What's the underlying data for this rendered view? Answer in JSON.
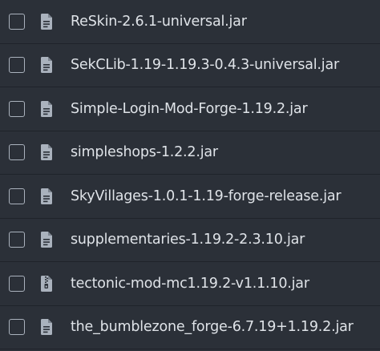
{
  "files": [
    {
      "name": "ReSkin-2.6.1-universal.jar",
      "icon": "document-icon"
    },
    {
      "name": "SekCLib-1.19-1.19.3-0.4.3-universal.jar",
      "icon": "document-icon"
    },
    {
      "name": "Simple-Login-Mod-Forge-1.19.2.jar",
      "icon": "document-icon"
    },
    {
      "name": "simpleshops-1.2.2.jar",
      "icon": "document-icon"
    },
    {
      "name": "SkyVillages-1.0.1-1.19-forge-release.jar",
      "icon": "document-icon"
    },
    {
      "name": "supplementaries-1.19.2-2.3.10.jar",
      "icon": "document-icon"
    },
    {
      "name": "tectonic-mod-mc1.19.2-v1.1.10.jar",
      "icon": "zip-archive-icon"
    },
    {
      "name": "the_bumblezone_forge-6.7.19+1.19.2.jar",
      "icon": "document-icon"
    }
  ],
  "colors": {
    "background": "#2b3038",
    "row_divider": "#1f232a",
    "text": "#dfe3e8",
    "icon": "#aab2bd"
  }
}
